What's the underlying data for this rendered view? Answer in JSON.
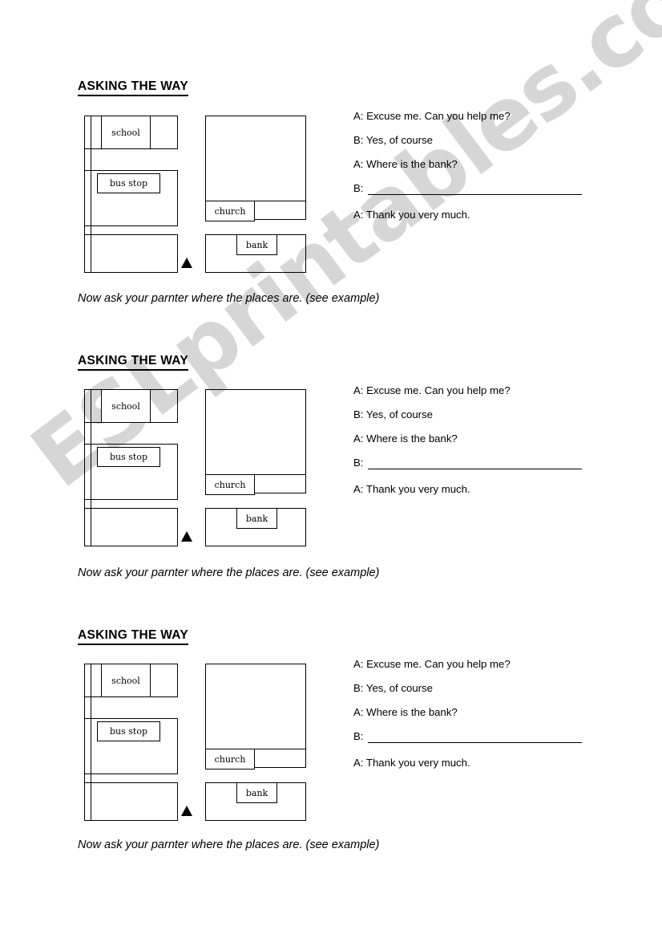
{
  "watermark": {
    "text": "ESLprintables.com",
    "color": "#d6d6d6"
  },
  "sections": [
    {
      "title": "ASKING THE WAY",
      "instruction": "Now ask your parnter where the places are. (see example)",
      "map": {
        "labels": [
          {
            "name": "school",
            "text": "school"
          },
          {
            "name": "bus-stop",
            "text": "bus stop"
          },
          {
            "name": "church",
            "text": "church"
          },
          {
            "name": "bank",
            "text": "bank"
          }
        ],
        "marker": "you-are-here-arrow"
      },
      "dialogue": [
        {
          "speaker": "A",
          "text": "A: Excuse me. Can you help me?",
          "blank": false
        },
        {
          "speaker": "B",
          "text": "B: Yes, of course",
          "blank": false
        },
        {
          "speaker": "A",
          "text": "A: Where is the bank?",
          "blank": false
        },
        {
          "speaker": "B",
          "text": "B:",
          "blank": true
        },
        {
          "speaker": "A",
          "text": "A: Thank you very much.",
          "blank": false
        }
      ]
    },
    {
      "title": "ASKING THE WAY",
      "instruction": "Now ask your parnter where the places are. (see example)",
      "map": {
        "labels": [
          {
            "name": "school",
            "text": "school"
          },
          {
            "name": "bus-stop",
            "text": "bus stop"
          },
          {
            "name": "church",
            "text": "church"
          },
          {
            "name": "bank",
            "text": "bank"
          }
        ],
        "marker": "you-are-here-arrow"
      },
      "dialogue": [
        {
          "speaker": "A",
          "text": "A: Excuse me. Can you help me?",
          "blank": false
        },
        {
          "speaker": "B",
          "text": "B: Yes, of course",
          "blank": false
        },
        {
          "speaker": "A",
          "text": "A: Where is the bank?",
          "blank": false
        },
        {
          "speaker": "B",
          "text": "B:",
          "blank": true
        },
        {
          "speaker": "A",
          "text": "A: Thank you very much.",
          "blank": false
        }
      ]
    },
    {
      "title": "ASKING THE WAY",
      "instruction": "Now ask your parnter where the places are. (see example)",
      "map": {
        "labels": [
          {
            "name": "school",
            "text": "school"
          },
          {
            "name": "bus-stop",
            "text": "bus stop"
          },
          {
            "name": "church",
            "text": "church"
          },
          {
            "name": "bank",
            "text": "bank"
          }
        ],
        "marker": "you-are-here-arrow"
      },
      "dialogue": [
        {
          "speaker": "A",
          "text": "A: Excuse me. Can you help me?",
          "blank": false
        },
        {
          "speaker": "B",
          "text": "B: Yes, of course",
          "blank": false
        },
        {
          "speaker": "A",
          "text": "A: Where is the bank?",
          "blank": false
        },
        {
          "speaker": "B",
          "text": "B:",
          "blank": true
        },
        {
          "speaker": "A",
          "text": "A: Thank you very much.",
          "blank": false
        }
      ]
    }
  ]
}
